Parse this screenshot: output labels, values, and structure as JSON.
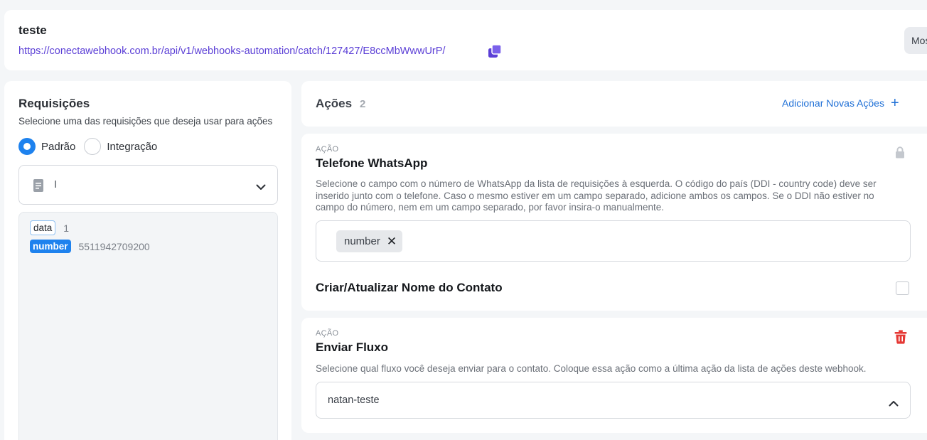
{
  "header": {
    "title": "teste",
    "url": "https://conectawebhook.com.br/api/v1/webhooks-automation/catch/127427/E8ccMbWwwUrP/",
    "show_button_label": "Mos"
  },
  "requests": {
    "title": "Requisições",
    "subtitle": "Selecione uma das requisições que deseja usar para ações",
    "radio_options": [
      "Padrão",
      "Integração"
    ],
    "selected_option": "Padrão",
    "select_value": "I",
    "fields": [
      {
        "key": "data",
        "value": "1"
      },
      {
        "key": "number",
        "value": "5511942709200"
      }
    ]
  },
  "actions": {
    "title": "Ações",
    "count": "2",
    "add_label": "Adicionar Novas Ações",
    "items": [
      {
        "kicker": "AÇÃO",
        "title": "Telefone WhatsApp",
        "description": "Selecione o campo com o número de WhatsApp da lista de requisições à esquerda. O código do país (DDI - country code) deve ser inserido junto com o telefone. Caso o mesmo estiver em um campo separado, adicione ambos os campos. Se o DDI não estiver no campo do número, nem em um campo separado, por favor insira-o manualmente.",
        "chip": "number",
        "contact_label": "Criar/Atualizar Nome do Contato",
        "contact_checked": false
      },
      {
        "kicker": "AÇÃO",
        "title": "Enviar Fluxo",
        "description": "Selecione qual fluxo você deseja enviar para o contato. Coloque essa ação como a última ação da lista de ações deste webhook.",
        "select_value": "natan-teste"
      }
    ]
  },
  "colors": {
    "accent": "#1e82ee",
    "link": "#5b3fd6",
    "danger": "#e53935"
  },
  "icons": [
    "copy-icon",
    "document-icon",
    "chevron-down-icon",
    "plus-icon",
    "lock-icon",
    "close-icon",
    "trash-icon",
    "chevron-up-icon"
  ]
}
